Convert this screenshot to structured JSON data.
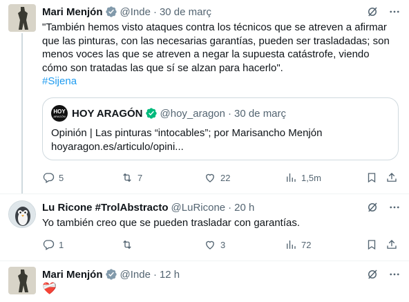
{
  "tweets": [
    {
      "name": "Mari Menjón",
      "handle": "@Inde",
      "separator": "·",
      "time": "30 de març",
      "text_lines": [
        "\"También hemos visto ataques contra los técnicos que se atreven a afirmar",
        "que las pinturas, con las necesarias garantías, pueden ser trasladadas; son",
        "menos voces las que se atreven a negar la supuesta catástrofe, viendo",
        "cómo son tratadas las que sí se alzan para hacerlo\"."
      ],
      "hashtag": "#Sijena",
      "quote": {
        "logo_line1": "HOY",
        "logo_line2": "ARAGÓN",
        "name": "HOY ARAGÓN",
        "handle": "@hoy_aragon",
        "separator": "·",
        "time": "30 de març",
        "line1": "Opinión | Las pinturas “intocables”; por Marisancho Menjón",
        "line2": "hoyaragon.es/articulo/opini..."
      },
      "actions": {
        "replies": "5",
        "reposts": "7",
        "likes": "22",
        "views": "1,5m"
      }
    },
    {
      "name": "Lu Ricone #TrolAbstracto",
      "handle": "@LuRicone",
      "separator": "·",
      "time": "20 h",
      "text": "Yo también creo que se pueden trasladar con garantías.",
      "actions": {
        "replies": "1",
        "reposts": "",
        "likes": "3",
        "views": "72"
      }
    },
    {
      "name": "Mari Menjón",
      "handle": "@Inde",
      "separator": "·",
      "time": "12 h",
      "emoji": "❤️‍🩹"
    }
  ],
  "icons": {
    "verified": "verified-badge-icon",
    "grok": "grok-icon",
    "more": "more-icon",
    "reply": "reply-icon",
    "repost": "repost-icon",
    "like": "like-icon",
    "views": "views-icon",
    "bookmark": "bookmark-icon",
    "share": "share-icon"
  },
  "colors": {
    "accent": "#1d9bf0",
    "secondary_text": "#536471",
    "border": "#cfd9de"
  }
}
